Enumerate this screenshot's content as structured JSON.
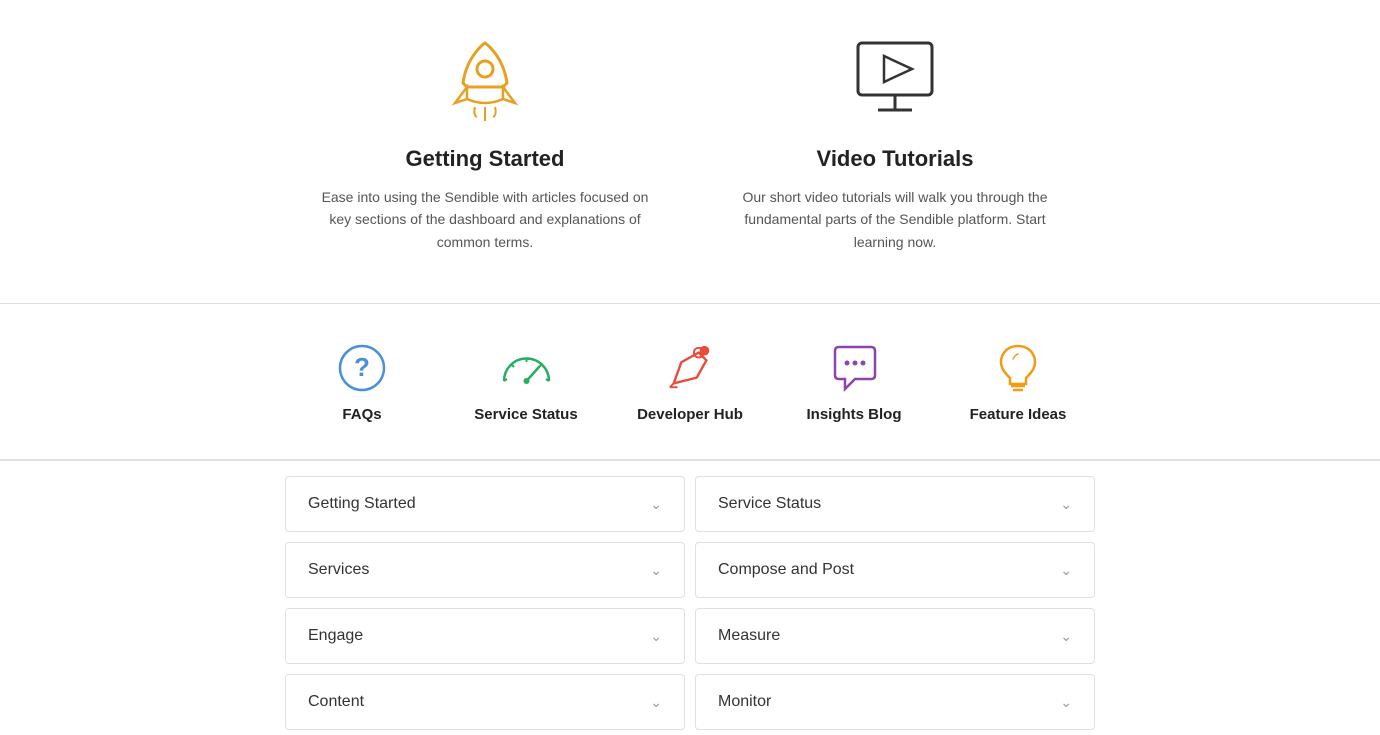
{
  "top_cards": [
    {
      "id": "getting-started",
      "title": "Getting Started",
      "description": "Ease into using the Sendible with articles focused on key sections of the dashboard and explanations of common terms."
    },
    {
      "id": "video-tutorials",
      "title": "Video Tutorials",
      "description": "Our short video tutorials will walk you through the fundamental parts of the Sendible platform. Start learning now."
    }
  ],
  "icon_strip": [
    {
      "id": "faqs",
      "label": "FAQs"
    },
    {
      "id": "service-status",
      "label": "Service Status"
    },
    {
      "id": "developer-hub",
      "label": "Developer Hub"
    },
    {
      "id": "insights-blog",
      "label": "Insights Blog"
    },
    {
      "id": "feature-ideas",
      "label": "Feature Ideas"
    }
  ],
  "accordion_items": [
    {
      "id": "getting-started-acc",
      "label": "Getting Started",
      "col": 0
    },
    {
      "id": "service-status-acc",
      "label": "Service Status",
      "col": 1
    },
    {
      "id": "services-acc",
      "label": "Services",
      "col": 0
    },
    {
      "id": "compose-post-acc",
      "label": "Compose and Post",
      "col": 1
    },
    {
      "id": "engage-acc",
      "label": "Engage",
      "col": 0
    },
    {
      "id": "measure-acc",
      "label": "Measure",
      "col": 1
    },
    {
      "id": "content-acc",
      "label": "Content",
      "col": 0
    },
    {
      "id": "monitor-acc",
      "label": "Monitor",
      "col": 1
    }
  ],
  "colors": {
    "rocket_orange": "#e8a020",
    "monitor_blue": "#444",
    "faq_blue": "#4a90d9",
    "service_green": "#27ae60",
    "dev_red": "#e74c3c",
    "insights_purple": "#8e44ad",
    "feature_yellow": "#f39c12"
  }
}
